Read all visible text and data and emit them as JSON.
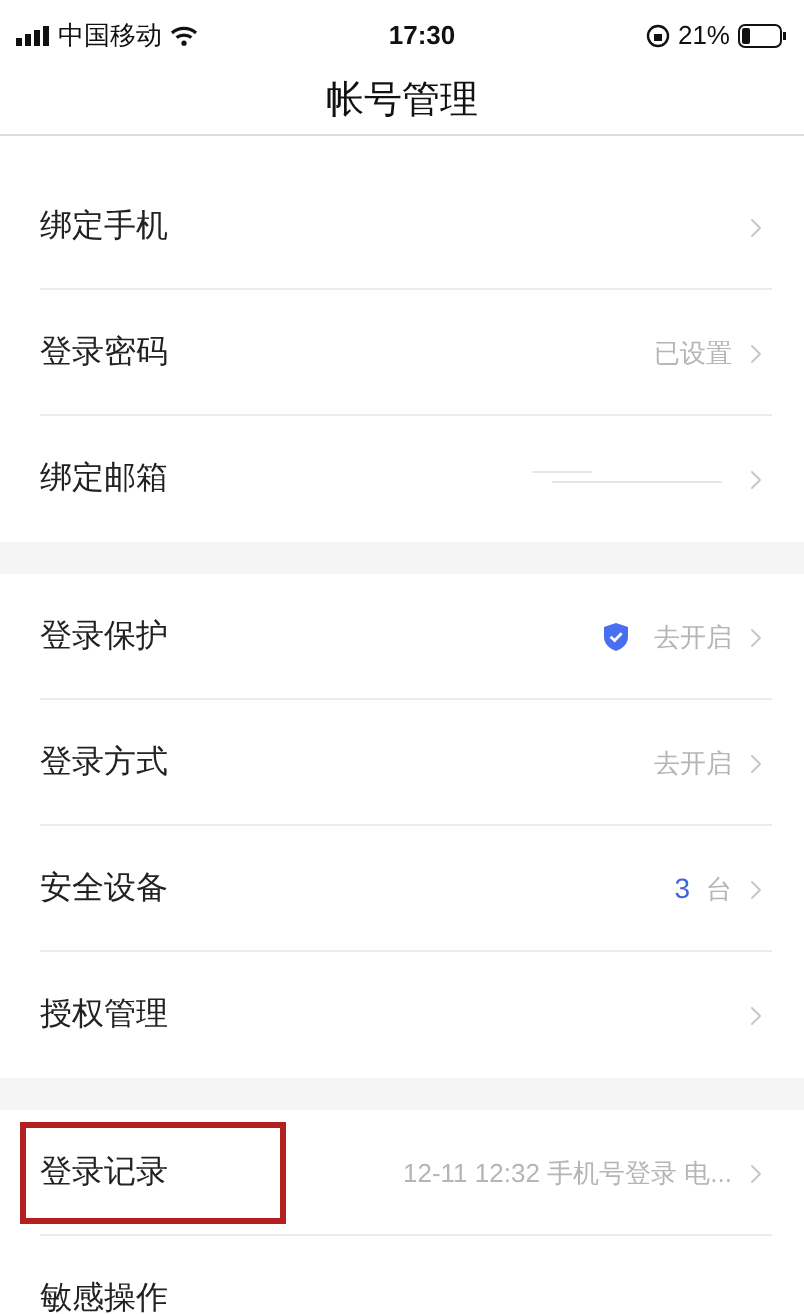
{
  "status_bar": {
    "carrier": "中国移动",
    "time": "17:30",
    "battery": "21%"
  },
  "nav": {
    "title": "帐号管理"
  },
  "groups": [
    [
      {
        "label": "绑定手机",
        "kind": "plain",
        "highlighted": false
      },
      {
        "label": "登录密码",
        "kind": "text",
        "value": "已设置",
        "highlighted": false
      },
      {
        "label": "绑定邮箱",
        "kind": "redacted",
        "highlighted": false
      }
    ],
    [
      {
        "label": "登录保护",
        "kind": "shield",
        "value": "去开启",
        "highlighted": false
      },
      {
        "label": "登录方式",
        "kind": "text",
        "value": "去开启",
        "highlighted": false
      },
      {
        "label": "安全设备",
        "kind": "count",
        "count": "3",
        "unit": "台",
        "highlighted": false
      },
      {
        "label": "授权管理",
        "kind": "plain",
        "highlighted": false
      }
    ],
    [
      {
        "label": "登录记录",
        "kind": "text",
        "value": "12-11 12:32 手机号登录 电...",
        "highlighted": true
      },
      {
        "label": "敏感操作",
        "kind": "bare",
        "highlighted": false
      }
    ]
  ]
}
